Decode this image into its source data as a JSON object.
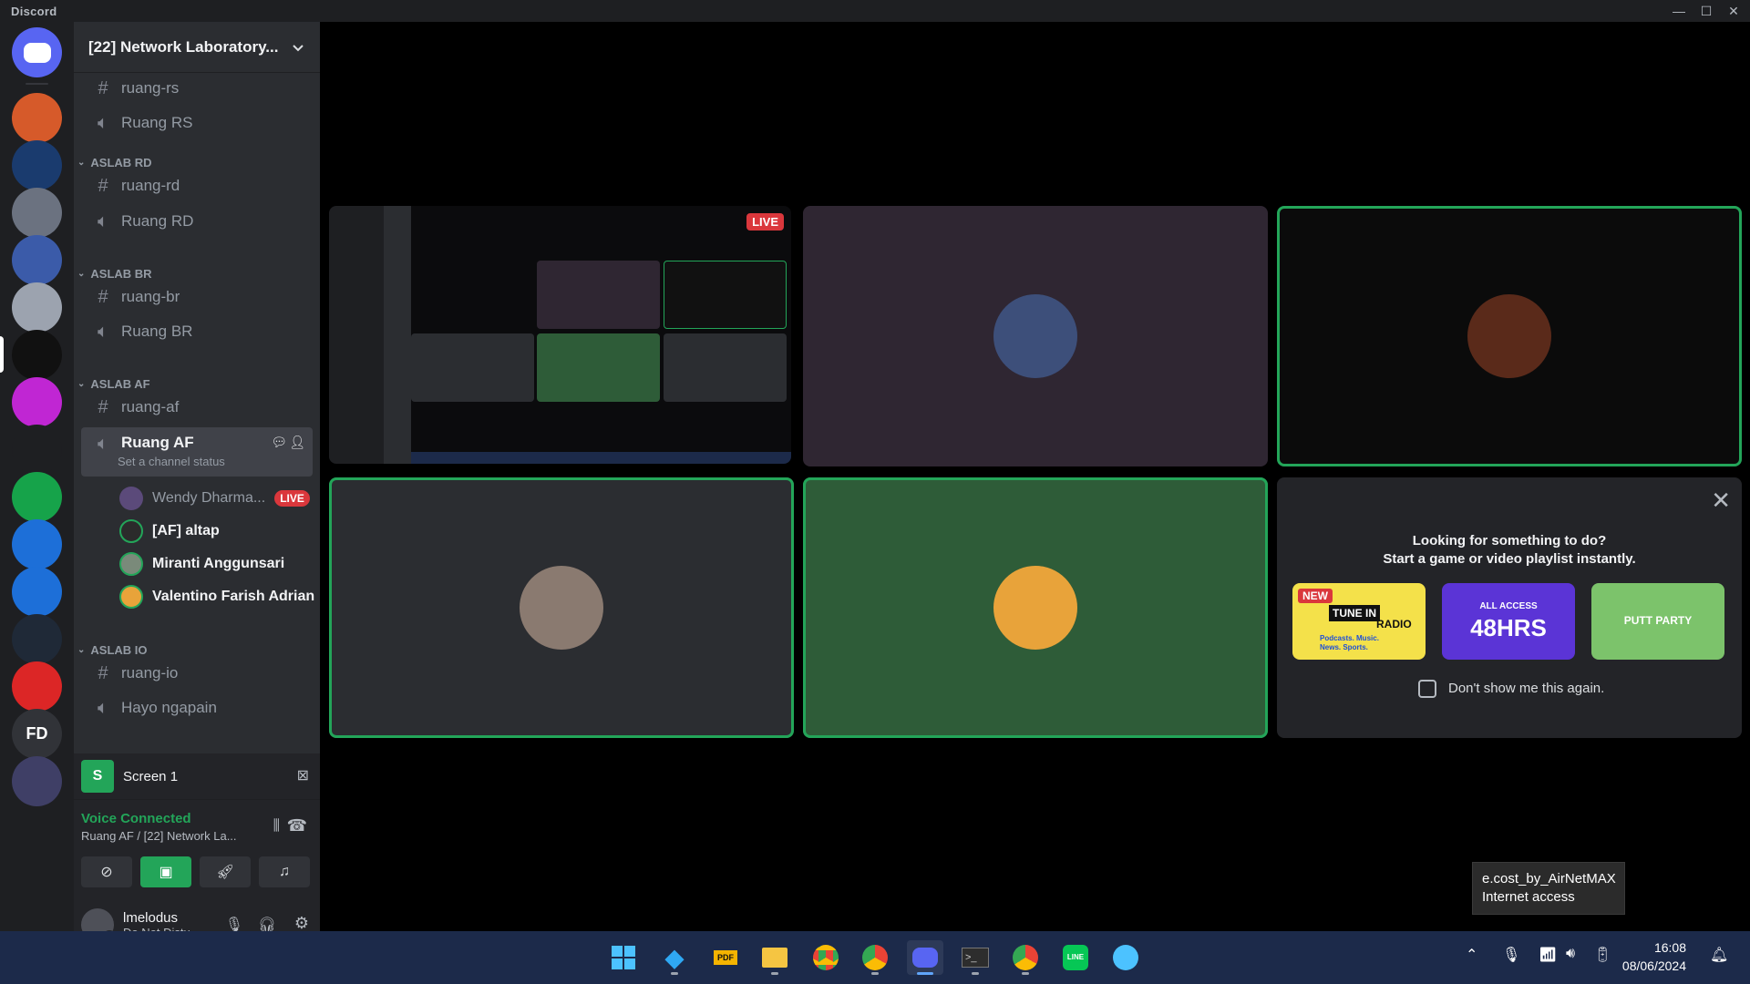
{
  "titlebar": {
    "app_name": "Discord"
  },
  "rail": {
    "servers": [
      {
        "name": "home",
        "initials": "",
        "color": "#5865f2"
      },
      {
        "name": "server-orange",
        "initials": "",
        "color": "#d65a2a"
      },
      {
        "name": "server-exercise",
        "initials": "",
        "color": "#1a3b6e"
      },
      {
        "name": "server-drone",
        "initials": "",
        "color": "#6b7280"
      },
      {
        "name": "server-art",
        "initials": "",
        "color": "#3b5ba9"
      },
      {
        "name": "server-plane",
        "initials": "",
        "color": "#9ca3af"
      },
      {
        "name": "server-netlab",
        "initials": "",
        "color": "#111111"
      },
      {
        "name": "server-d-magenta",
        "initials": "",
        "color": "#c026d3"
      },
      {
        "name": "server-cat",
        "initials": "",
        "color": "#1e1f22"
      },
      {
        "name": "server-d-green",
        "initials": "",
        "color": "#16a34a"
      },
      {
        "name": "server-d-blue",
        "initials": "",
        "color": "#1d6fd8"
      },
      {
        "name": "server-d-blue2",
        "initials": "",
        "color": "#1d6fd8"
      },
      {
        "name": "server-auav",
        "initials": "",
        "color": "#1f2937"
      },
      {
        "name": "server-sesak-napas",
        "initials": "",
        "color": "#dc2626"
      },
      {
        "name": "server-fd",
        "initials": "FD",
        "color": "#313338"
      },
      {
        "name": "server-robot",
        "initials": "",
        "color": "#3f3f66"
      }
    ]
  },
  "sidebar": {
    "guild_name": "[22] Network Laboratory...",
    "channels": {
      "ruang_rs_text": "ruang-rs",
      "ruang_rs_voice": "Ruang RS",
      "cat_rd": "ASLAB RD",
      "ruang_rd_text": "ruang-rd",
      "ruang_rd_voice": "Ruang RD",
      "cat_br": "ASLAB BR",
      "ruang_br_text": "ruang-br",
      "ruang_br_voice": "Ruang BR",
      "cat_af": "ASLAB AF",
      "ruang_af_text": "ruang-af",
      "ruang_af_voice": "Ruang AF",
      "ruang_af_status": "Set a channel status",
      "cat_io": "ASLAB IO",
      "ruang_io_text": "ruang-io",
      "hayo_voice": "Hayo ngapain"
    },
    "voice_users": [
      {
        "name": "Wendy Dharma...",
        "live": "LIVE",
        "color": "#5b4a7a"
      },
      {
        "name": "[AF] altap",
        "live": "",
        "color": "#2b2b2b"
      },
      {
        "name": "Miranti Anggunsari",
        "live": "",
        "color": "#7a8a7a"
      },
      {
        "name": "Valentino Farish Adrian",
        "live": "",
        "color": "#e8a33a"
      }
    ],
    "screen_share": {
      "thumb_letter": "S",
      "label": "Screen 1"
    },
    "voice": {
      "status": "Voice Connected",
      "location": "Ruang AF / [22] Network La..."
    },
    "user": {
      "name": "lmelodus",
      "status": "Do Not Distu..."
    }
  },
  "stage": {
    "live_label": "LIVE",
    "tiles": [
      {
        "name": "screen-share-tile",
        "bg": "#0b0b0d",
        "avatar": ""
      },
      {
        "name": "participant-wendy",
        "bg": "#2f2632",
        "avatar": "#3d4f7a"
      },
      {
        "name": "participant-altap",
        "bg": "#0b0b0b",
        "avatar": "#5a2a1a"
      },
      {
        "name": "participant-miranti",
        "bg": "#2b2d31",
        "avatar": "#8a7a70"
      },
      {
        "name": "participant-valentino",
        "bg": "#2e5c38",
        "avatar": "#e8a33a"
      }
    ],
    "activity": {
      "title_line1": "Looking for something to do?",
      "title_line2": "Start a game or video playlist instantly.",
      "cards": [
        {
          "name": "tunein-radio",
          "badge": "NEW",
          "line1": "TUNE IN",
          "line2": "RADIO",
          "line3": "Podcasts. Music. News. Sports."
        },
        {
          "name": "all-access-48hrs",
          "badge": "",
          "line1": "ALL ACCESS",
          "line2": "48HRS",
          "line3": ""
        },
        {
          "name": "putt-party",
          "badge": "",
          "line1": "PUTT PARTY",
          "line2": "",
          "line3": ""
        }
      ],
      "checkbox_label": "Don't show me this again."
    }
  },
  "tooltip": {
    "line1": "e.cost_by_AirNetMAX",
    "line2": "Internet access"
  },
  "taskbar": {
    "apps": [
      "start",
      "vscode",
      "pdf",
      "file-explorer",
      "chrome",
      "chrome-profile",
      "discord",
      "terminal",
      "chrome-profile-2",
      "line",
      "paint"
    ],
    "time": "16:08",
    "date": "08/06/2024"
  }
}
